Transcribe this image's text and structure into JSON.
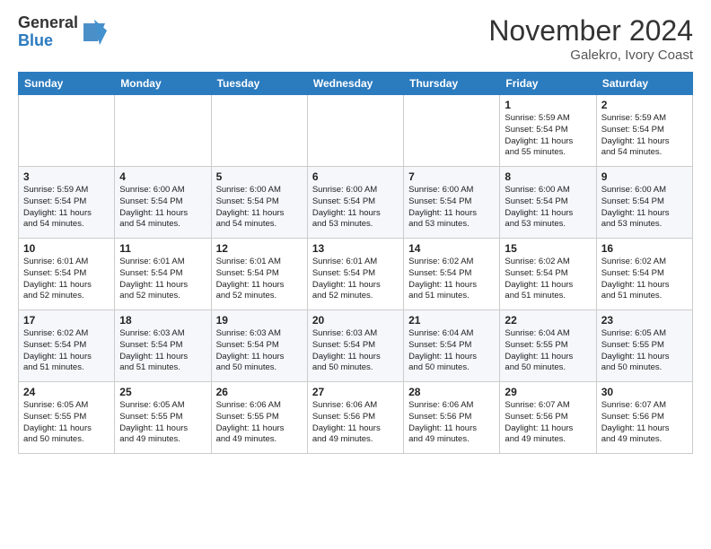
{
  "logo": {
    "general": "General",
    "blue": "Blue"
  },
  "title": "November 2024",
  "location": "Galekro, Ivory Coast",
  "days_of_week": [
    "Sunday",
    "Monday",
    "Tuesday",
    "Wednesday",
    "Thursday",
    "Friday",
    "Saturday"
  ],
  "weeks": [
    [
      {
        "day": "",
        "info": ""
      },
      {
        "day": "",
        "info": ""
      },
      {
        "day": "",
        "info": ""
      },
      {
        "day": "",
        "info": ""
      },
      {
        "day": "",
        "info": ""
      },
      {
        "day": "1",
        "info": "Sunrise: 5:59 AM\nSunset: 5:54 PM\nDaylight: 11 hours\nand 55 minutes."
      },
      {
        "day": "2",
        "info": "Sunrise: 5:59 AM\nSunset: 5:54 PM\nDaylight: 11 hours\nand 54 minutes."
      }
    ],
    [
      {
        "day": "3",
        "info": "Sunrise: 5:59 AM\nSunset: 5:54 PM\nDaylight: 11 hours\nand 54 minutes."
      },
      {
        "day": "4",
        "info": "Sunrise: 6:00 AM\nSunset: 5:54 PM\nDaylight: 11 hours\nand 54 minutes."
      },
      {
        "day": "5",
        "info": "Sunrise: 6:00 AM\nSunset: 5:54 PM\nDaylight: 11 hours\nand 54 minutes."
      },
      {
        "day": "6",
        "info": "Sunrise: 6:00 AM\nSunset: 5:54 PM\nDaylight: 11 hours\nand 53 minutes."
      },
      {
        "day": "7",
        "info": "Sunrise: 6:00 AM\nSunset: 5:54 PM\nDaylight: 11 hours\nand 53 minutes."
      },
      {
        "day": "8",
        "info": "Sunrise: 6:00 AM\nSunset: 5:54 PM\nDaylight: 11 hours\nand 53 minutes."
      },
      {
        "day": "9",
        "info": "Sunrise: 6:00 AM\nSunset: 5:54 PM\nDaylight: 11 hours\nand 53 minutes."
      }
    ],
    [
      {
        "day": "10",
        "info": "Sunrise: 6:01 AM\nSunset: 5:54 PM\nDaylight: 11 hours\nand 52 minutes."
      },
      {
        "day": "11",
        "info": "Sunrise: 6:01 AM\nSunset: 5:54 PM\nDaylight: 11 hours\nand 52 minutes."
      },
      {
        "day": "12",
        "info": "Sunrise: 6:01 AM\nSunset: 5:54 PM\nDaylight: 11 hours\nand 52 minutes."
      },
      {
        "day": "13",
        "info": "Sunrise: 6:01 AM\nSunset: 5:54 PM\nDaylight: 11 hours\nand 52 minutes."
      },
      {
        "day": "14",
        "info": "Sunrise: 6:02 AM\nSunset: 5:54 PM\nDaylight: 11 hours\nand 51 minutes."
      },
      {
        "day": "15",
        "info": "Sunrise: 6:02 AM\nSunset: 5:54 PM\nDaylight: 11 hours\nand 51 minutes."
      },
      {
        "day": "16",
        "info": "Sunrise: 6:02 AM\nSunset: 5:54 PM\nDaylight: 11 hours\nand 51 minutes."
      }
    ],
    [
      {
        "day": "17",
        "info": "Sunrise: 6:02 AM\nSunset: 5:54 PM\nDaylight: 11 hours\nand 51 minutes."
      },
      {
        "day": "18",
        "info": "Sunrise: 6:03 AM\nSunset: 5:54 PM\nDaylight: 11 hours\nand 51 minutes."
      },
      {
        "day": "19",
        "info": "Sunrise: 6:03 AM\nSunset: 5:54 PM\nDaylight: 11 hours\nand 50 minutes."
      },
      {
        "day": "20",
        "info": "Sunrise: 6:03 AM\nSunset: 5:54 PM\nDaylight: 11 hours\nand 50 minutes."
      },
      {
        "day": "21",
        "info": "Sunrise: 6:04 AM\nSunset: 5:54 PM\nDaylight: 11 hours\nand 50 minutes."
      },
      {
        "day": "22",
        "info": "Sunrise: 6:04 AM\nSunset: 5:55 PM\nDaylight: 11 hours\nand 50 minutes."
      },
      {
        "day": "23",
        "info": "Sunrise: 6:05 AM\nSunset: 5:55 PM\nDaylight: 11 hours\nand 50 minutes."
      }
    ],
    [
      {
        "day": "24",
        "info": "Sunrise: 6:05 AM\nSunset: 5:55 PM\nDaylight: 11 hours\nand 50 minutes."
      },
      {
        "day": "25",
        "info": "Sunrise: 6:05 AM\nSunset: 5:55 PM\nDaylight: 11 hours\nand 49 minutes."
      },
      {
        "day": "26",
        "info": "Sunrise: 6:06 AM\nSunset: 5:55 PM\nDaylight: 11 hours\nand 49 minutes."
      },
      {
        "day": "27",
        "info": "Sunrise: 6:06 AM\nSunset: 5:56 PM\nDaylight: 11 hours\nand 49 minutes."
      },
      {
        "day": "28",
        "info": "Sunrise: 6:06 AM\nSunset: 5:56 PM\nDaylight: 11 hours\nand 49 minutes."
      },
      {
        "day": "29",
        "info": "Sunrise: 6:07 AM\nSunset: 5:56 PM\nDaylight: 11 hours\nand 49 minutes."
      },
      {
        "day": "30",
        "info": "Sunrise: 6:07 AM\nSunset: 5:56 PM\nDaylight: 11 hours\nand 49 minutes."
      }
    ]
  ]
}
